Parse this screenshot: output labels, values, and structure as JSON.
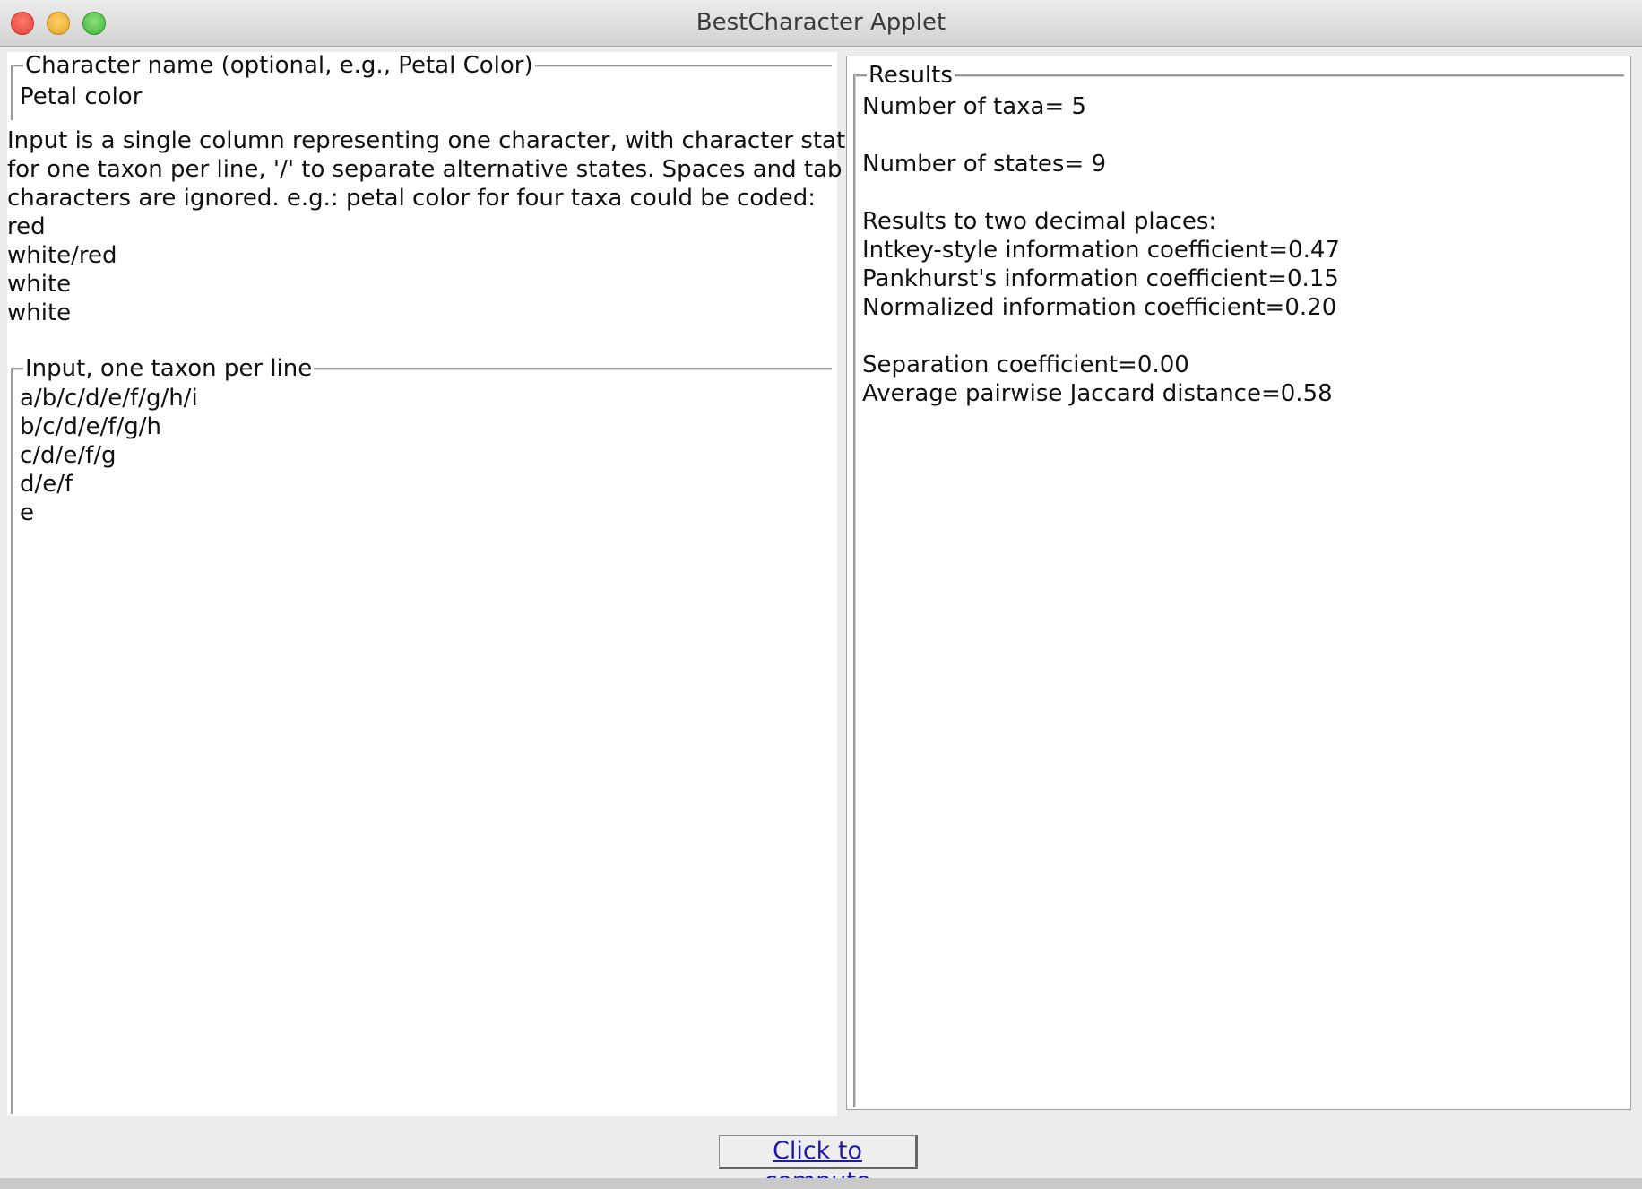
{
  "window": {
    "title": "BestCharacter Applet"
  },
  "character_name": {
    "legend": "Character name (optional, e.g., Petal Color)",
    "value": "Petal color"
  },
  "description": {
    "lines": [
      "Input is a single column representing one character, with character states",
      "for one taxon per line, '/' to separate alternative states. Spaces and tab",
      "characters are ignored. e.g.: petal color for four taxa could be coded:",
      "red",
      "white/red",
      "white",
      "white"
    ]
  },
  "input": {
    "legend": "Input, one taxon per line",
    "lines": [
      "a/b/c/d/e/f/g/h/i",
      "b/c/d/e/f/g/h",
      "c/d/e/f/g",
      "d/e/f",
      "e"
    ]
  },
  "results": {
    "legend": "Results",
    "lines": [
      "Number of taxa= 5",
      "",
      "Number of states= 9",
      "",
      "Results to two decimal places:",
      "Intkey-style information coefficient=0.47",
      "Pankhurst's information coefficient=0.15",
      "Normalized information coefficient=0.20",
      "",
      "Separation coefficient=0.00",
      "Average pairwise Jaccard distance=0.58"
    ]
  },
  "compute_button": {
    "label": "Click to compute"
  }
}
